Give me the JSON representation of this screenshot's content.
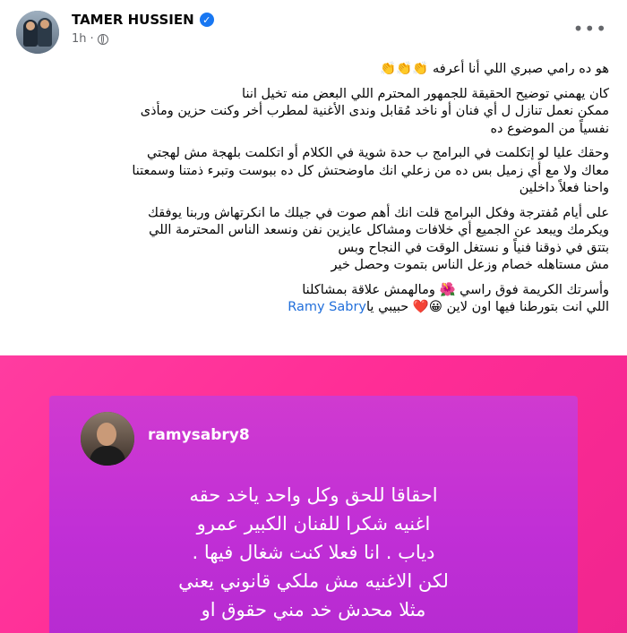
{
  "post": {
    "author": "TAMER HUSSIEN",
    "time": "1h",
    "more_label": "•••",
    "paragraphs": [
      [
        "هو ده رامي صبري اللي أنا أعرفه 👏👏👏"
      ],
      [
        "كان يهمني توضيح الحقيقة للجمهور المحترم اللي البعض منه تخيل اننا",
        "ممكن نعمل تنازل ل أي فنان أو ناخد مُقابل وندى الأغنية لمطرب أخر  وكنت حزين ومأذى",
        "نفسياً من الموضوع ده"
      ],
      [
        "وحقك عليا لو إتكلمت في البرامج ب حدة شوية   في الكلام أو اتكلمت بلهجة مش لهجتي",
        "معاك ولا مع أي زميل بس ده من زعلي انك ماوضحتش كل ده  ببوست وتبرء  ذمتنا وسمعتنا",
        "واحنا فعلاً داخلين"
      ],
      [
        "على أيام مُفترجة وفكل البرامج  قلت انك أهم صوت في جيلك ما انكرتهاش وربنا يوفقك",
        "ويكرمك ويبعد عن الجميع أي خلافات ومشاكل عايزين نفن ونسعد الناس المحترمة اللي",
        "بتتق في ذوقنا فنياً و نستغل الوقت في النجاح وبس",
        "مش مستاهله خصام وزعل  الناس بتموت وحصل خير"
      ],
      [
        "وأسرتك الكريمة فوق راسي 🌺 ومالهمش علاقة بمشاكلنا"
      ]
    ],
    "last_line_text": "اللي انت بتورطنا فيها اون لاين 😀❤️ حبيبي يا",
    "last_line_link": "Ramy Sabry"
  },
  "story": {
    "username": "ramysabry8",
    "lines": [
      "احقاقا للحق وكل واحد ياخد حقه",
      "اغنيه شكرا للفنان الكبير عمرو",
      "دياب . انا فعلا كنت شغال فيها .",
      "لكن الاغنيه مش ملكي قانوني يعني",
      "مثلا محدش خد مني حقوق او"
    ]
  },
  "colors": {
    "link": "#216fdb",
    "verified": "#1877f2",
    "media_bg": "#ff2d96",
    "story_bg": "#c12fd6"
  }
}
